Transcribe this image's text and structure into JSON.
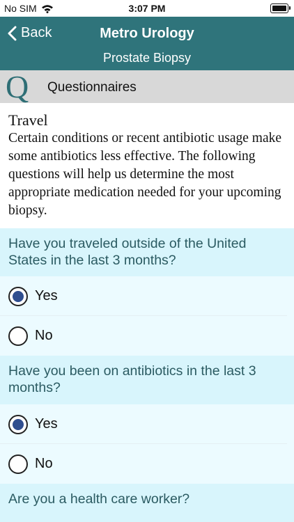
{
  "status_bar": {
    "carrier": "No SIM",
    "time": "3:07 PM",
    "wifi_icon": "wifi-icon",
    "battery_icon": "battery-icon"
  },
  "nav": {
    "back_label": "Back",
    "title": "Metro Urology",
    "subtitle": "Prostate Biopsy"
  },
  "section": {
    "logo": "Q",
    "label": "Questionnaires"
  },
  "intro": {
    "title": "Travel",
    "text": "Certain conditions or recent antibiotic usage make some antibiotics less effective. The following questions will help us determine the most appropriate medication needed for your upcoming biopsy."
  },
  "questions": [
    {
      "text": "Have you traveled outside of the United States in the last 3 months?",
      "options": [
        {
          "label": "Yes",
          "selected": true
        },
        {
          "label": "No",
          "selected": false
        }
      ]
    },
    {
      "text": "Have you been on antibiotics in the last 3 months?",
      "options": [
        {
          "label": "Yes",
          "selected": true
        },
        {
          "label": "No",
          "selected": false
        }
      ]
    },
    {
      "text": "Are you a health care worker?"
    }
  ],
  "colors": {
    "nav_bg": "#2f747b",
    "question_bg": "#d8f5fc",
    "option_bg": "#ecfbff",
    "radio_selected": "#2f4e8f"
  }
}
